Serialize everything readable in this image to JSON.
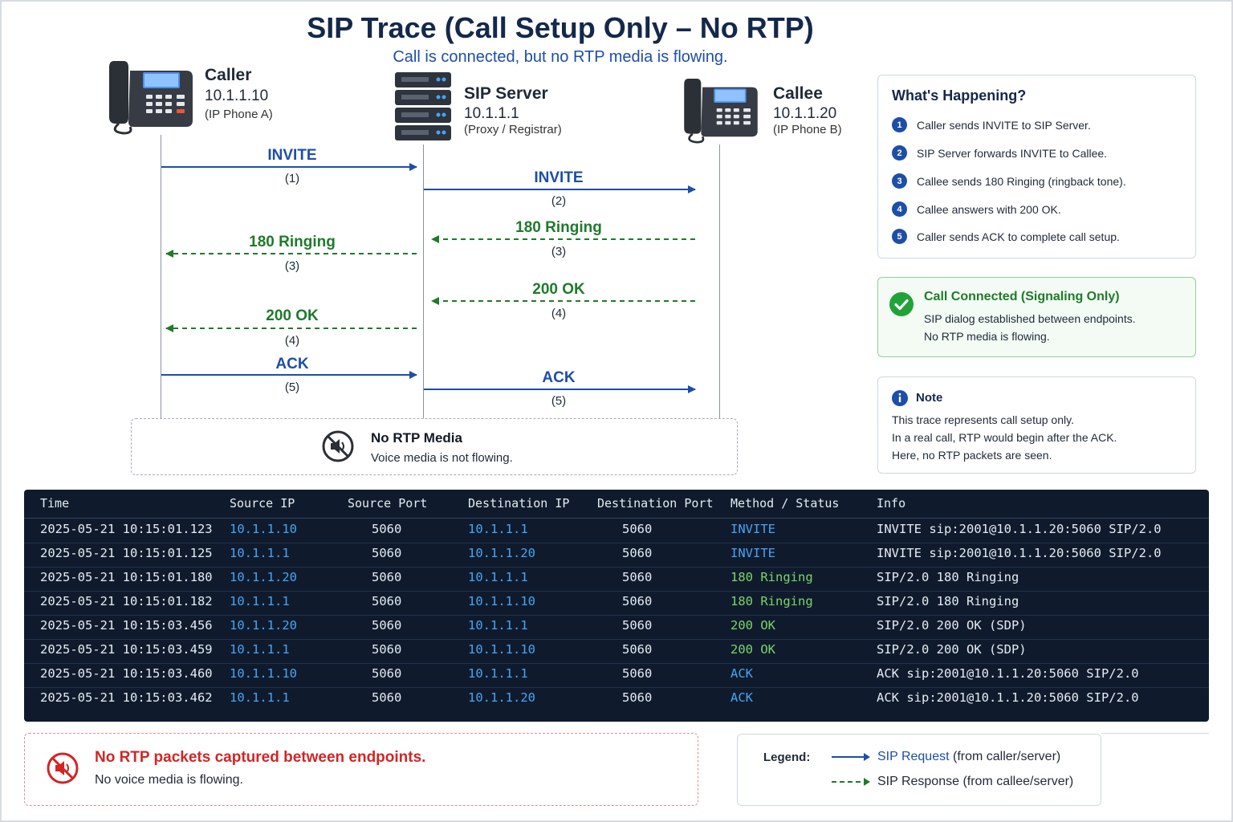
{
  "header": {
    "title": "SIP Trace (Call Setup Only – No RTP)",
    "subtitle": "Call is connected, but no RTP media is flowing."
  },
  "endpoints": {
    "caller": {
      "name": "Caller",
      "ip": "10.1.1.10",
      "role": "(IP Phone A)",
      "icon": "desk-phone-icon"
    },
    "server": {
      "name": "SIP Server",
      "ip": "10.1.1.1",
      "role": "(Proxy / Registrar)",
      "icon": "server-rack-icon"
    },
    "callee": {
      "name": "Callee",
      "ip": "10.1.1.20",
      "role": "(IP Phone B)",
      "icon": "desk-phone-icon"
    }
  },
  "messages": [
    {
      "label": "INVITE",
      "step": "(1)",
      "from": "caller",
      "to": "server",
      "kind": "request"
    },
    {
      "label": "INVITE",
      "step": "(2)",
      "from": "server",
      "to": "callee",
      "kind": "request"
    },
    {
      "label": "180 Ringing",
      "step": "(3)",
      "from": "callee",
      "to": "server",
      "kind": "response"
    },
    {
      "label": "180 Ringing",
      "step": "(3)",
      "from": "server",
      "to": "caller",
      "kind": "response"
    },
    {
      "label": "200 OK",
      "step": "(4)",
      "from": "callee",
      "to": "server",
      "kind": "response"
    },
    {
      "label": "200 OK",
      "step": "(4)",
      "from": "server",
      "to": "caller",
      "kind": "response"
    },
    {
      "label": "ACK",
      "step": "(5)",
      "from": "caller",
      "to": "server",
      "kind": "request"
    },
    {
      "label": "ACK",
      "step": "(5)",
      "from": "server",
      "to": "callee",
      "kind": "request"
    }
  ],
  "no_rtp": {
    "title": "No RTP Media",
    "subtitle": "Voice media is not flowing.",
    "icon": "muted-speaker-icon"
  },
  "whats_happening": {
    "title": "What's Happening?",
    "items": [
      {
        "num": "1",
        "text": "Caller sends INVITE to SIP Server."
      },
      {
        "num": "2",
        "text": "SIP Server forwards INVITE to Callee."
      },
      {
        "num": "3",
        "text": "Callee sends 180 Ringing (ringback tone)."
      },
      {
        "num": "4",
        "text": "Callee answers with 200 OK."
      },
      {
        "num": "5",
        "text": "Caller sends ACK to complete call setup."
      }
    ]
  },
  "connected": {
    "title": "Call Connected (Signaling Only)",
    "lines": [
      "SIP dialog established between endpoints.",
      "No RTP media is flowing."
    ],
    "icon": "check-circle-icon"
  },
  "note": {
    "title": "Note",
    "lines": [
      "This trace represents call setup only.",
      "In a real call, RTP would begin after the ACK.",
      "Here, no RTP packets are seen."
    ],
    "icon": "info-icon"
  },
  "table": {
    "columns": [
      "Time",
      "Source IP",
      "Source Port",
      "Destination IP",
      "Destination Port",
      "Method / Status",
      "Info"
    ],
    "rows": [
      [
        "2025-05-21 10:15:01.123",
        "10.1.1.10",
        "5060",
        "10.1.1.1",
        "5060",
        "INVITE",
        "INVITE sip:2001@10.1.1.20:5060 SIP/2.0"
      ],
      [
        "2025-05-21 10:15:01.125",
        "10.1.1.1",
        "5060",
        "10.1.1.20",
        "5060",
        "INVITE",
        "INVITE sip:2001@10.1.1.20:5060 SIP/2.0"
      ],
      [
        "2025-05-21 10:15:01.180",
        "10.1.1.20",
        "5060",
        "10.1.1.1",
        "5060",
        "180 Ringing",
        "SIP/2.0 180 Ringing"
      ],
      [
        "2025-05-21 10:15:01.182",
        "10.1.1.1",
        "5060",
        "10.1.1.10",
        "5060",
        "180 Ringing",
        "SIP/2.0 180 Ringing"
      ],
      [
        "2025-05-21 10:15:03.456",
        "10.1.1.20",
        "5060",
        "10.1.1.1",
        "5060",
        "200 OK",
        "SIP/2.0 200 OK  (SDP)"
      ],
      [
        "2025-05-21 10:15:03.459",
        "10.1.1.1",
        "5060",
        "10.1.1.10",
        "5060",
        "200 OK",
        "SIP/2.0 200 OK  (SDP)"
      ],
      [
        "2025-05-21 10:15:03.460",
        "10.1.1.10",
        "5060",
        "10.1.1.1",
        "5060",
        "ACK",
        "ACK sip:2001@10.1.1.20:5060 SIP/2.0"
      ],
      [
        "2025-05-21 10:15:03.462",
        "10.1.1.1",
        "5060",
        "10.1.1.20",
        "5060",
        "ACK",
        "ACK sip:2001@10.1.1.20:5060 SIP/2.0"
      ]
    ]
  },
  "alert": {
    "title": "No RTP packets captured between endpoints.",
    "subtitle": "No voice media is flowing.",
    "icon": "muted-speaker-icon"
  },
  "legend": {
    "label": "Legend:",
    "request_title": "SIP Request",
    "request_desc": " (from caller/server)",
    "response_title": "SIP Response",
    "response_desc": " (from callee/server)"
  },
  "colors": {
    "request": "#1d4ea8",
    "response": "#1f7a2c",
    "alert": "#d32525",
    "table_bg": "#0f1b2d"
  }
}
